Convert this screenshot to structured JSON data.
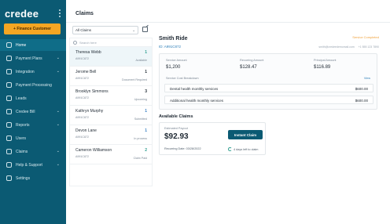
{
  "brand": {
    "name": "credee"
  },
  "sidebar": {
    "cta_label": "+ Finance Customer",
    "items": [
      {
        "label": "Home",
        "icon": "home-icon",
        "active": true,
        "has_chevron": false
      },
      {
        "label": "Payment Plans",
        "icon": "payment-plans-icon",
        "active": false,
        "has_chevron": true
      },
      {
        "label": "Integration",
        "icon": "integration-icon",
        "active": false,
        "has_chevron": true
      },
      {
        "label": "Payment Processing",
        "icon": "payment-processing-icon",
        "active": false,
        "has_chevron": false
      },
      {
        "label": "Leads",
        "icon": "leads-icon",
        "active": false,
        "has_chevron": false
      },
      {
        "label": "Credee Bill",
        "icon": "bill-icon",
        "active": false,
        "has_chevron": true
      },
      {
        "label": "Reports",
        "icon": "reports-icon",
        "active": false,
        "has_chevron": true
      },
      {
        "label": "Users",
        "icon": "users-icon",
        "active": false,
        "has_chevron": false
      },
      {
        "label": "Claims",
        "icon": "claims-icon",
        "active": false,
        "has_chevron": true
      },
      {
        "label": "Help & Support",
        "icon": "help-icon",
        "active": false,
        "has_chevron": true
      },
      {
        "label": "Settings",
        "icon": "settings-icon",
        "active": false,
        "has_chevron": false
      }
    ]
  },
  "header": {
    "title": "Claims"
  },
  "filter": {
    "value": "All Claims"
  },
  "search": {
    "placeholder": "Search here"
  },
  "claims": [
    {
      "name": "Theresa Webb",
      "id": "A991C872",
      "count": "1",
      "status": "Available",
      "count_color": "green"
    },
    {
      "name": "Jerome Bell",
      "id": "A991C872",
      "count": "1",
      "status": "Document Required",
      "count_color": "default"
    },
    {
      "name": "Brooklyn Simmons",
      "id": "A991C872",
      "count": "3",
      "status": "Upcoming",
      "count_color": "default"
    },
    {
      "name": "Kathryn Murphy",
      "id": "A991C872",
      "count": "1",
      "status": "Submitted",
      "count_color": "blue"
    },
    {
      "name": "Devon Lane",
      "id": "A991C872",
      "count": "1",
      "status": "In process",
      "count_color": "blue"
    },
    {
      "name": "Cameron Williamson",
      "id": "A991C872",
      "count": "2",
      "status": "Claim Paid",
      "count_color": "green"
    }
  ],
  "detail": {
    "name": "Smith Ride",
    "id": "ID: A991C872",
    "status": "Service Completed",
    "email": "smith@credeedemomail.com",
    "phone": "+1 555 123 7890",
    "metrics": [
      {
        "label": "Service Amount",
        "value": "$1,200"
      },
      {
        "label": "Recurring Amount",
        "value": "$128.47"
      },
      {
        "label": "Principal Amount",
        "value": "$116.89"
      }
    ],
    "breakdown_label": "Service Cost Breakdown",
    "breakdown_link": "View",
    "breakdown": [
      {
        "label": "Dental health monthly services",
        "amount": "$600.00"
      },
      {
        "label": "Additional health monthly services",
        "amount": "$600.00"
      }
    ]
  },
  "available": {
    "title": "Available Claims",
    "est_label": "Estimated Payout",
    "est_value": "$92.93",
    "button_label": "Instant Claim",
    "recurring_date": "Recurring Date: 03/28/2022",
    "days_left": "4 days left to claim"
  },
  "colors": {
    "sidebar": "#0b5a73",
    "accent": "#f5a623",
    "link": "#2e7fb8",
    "success": "#2e9e8f"
  }
}
